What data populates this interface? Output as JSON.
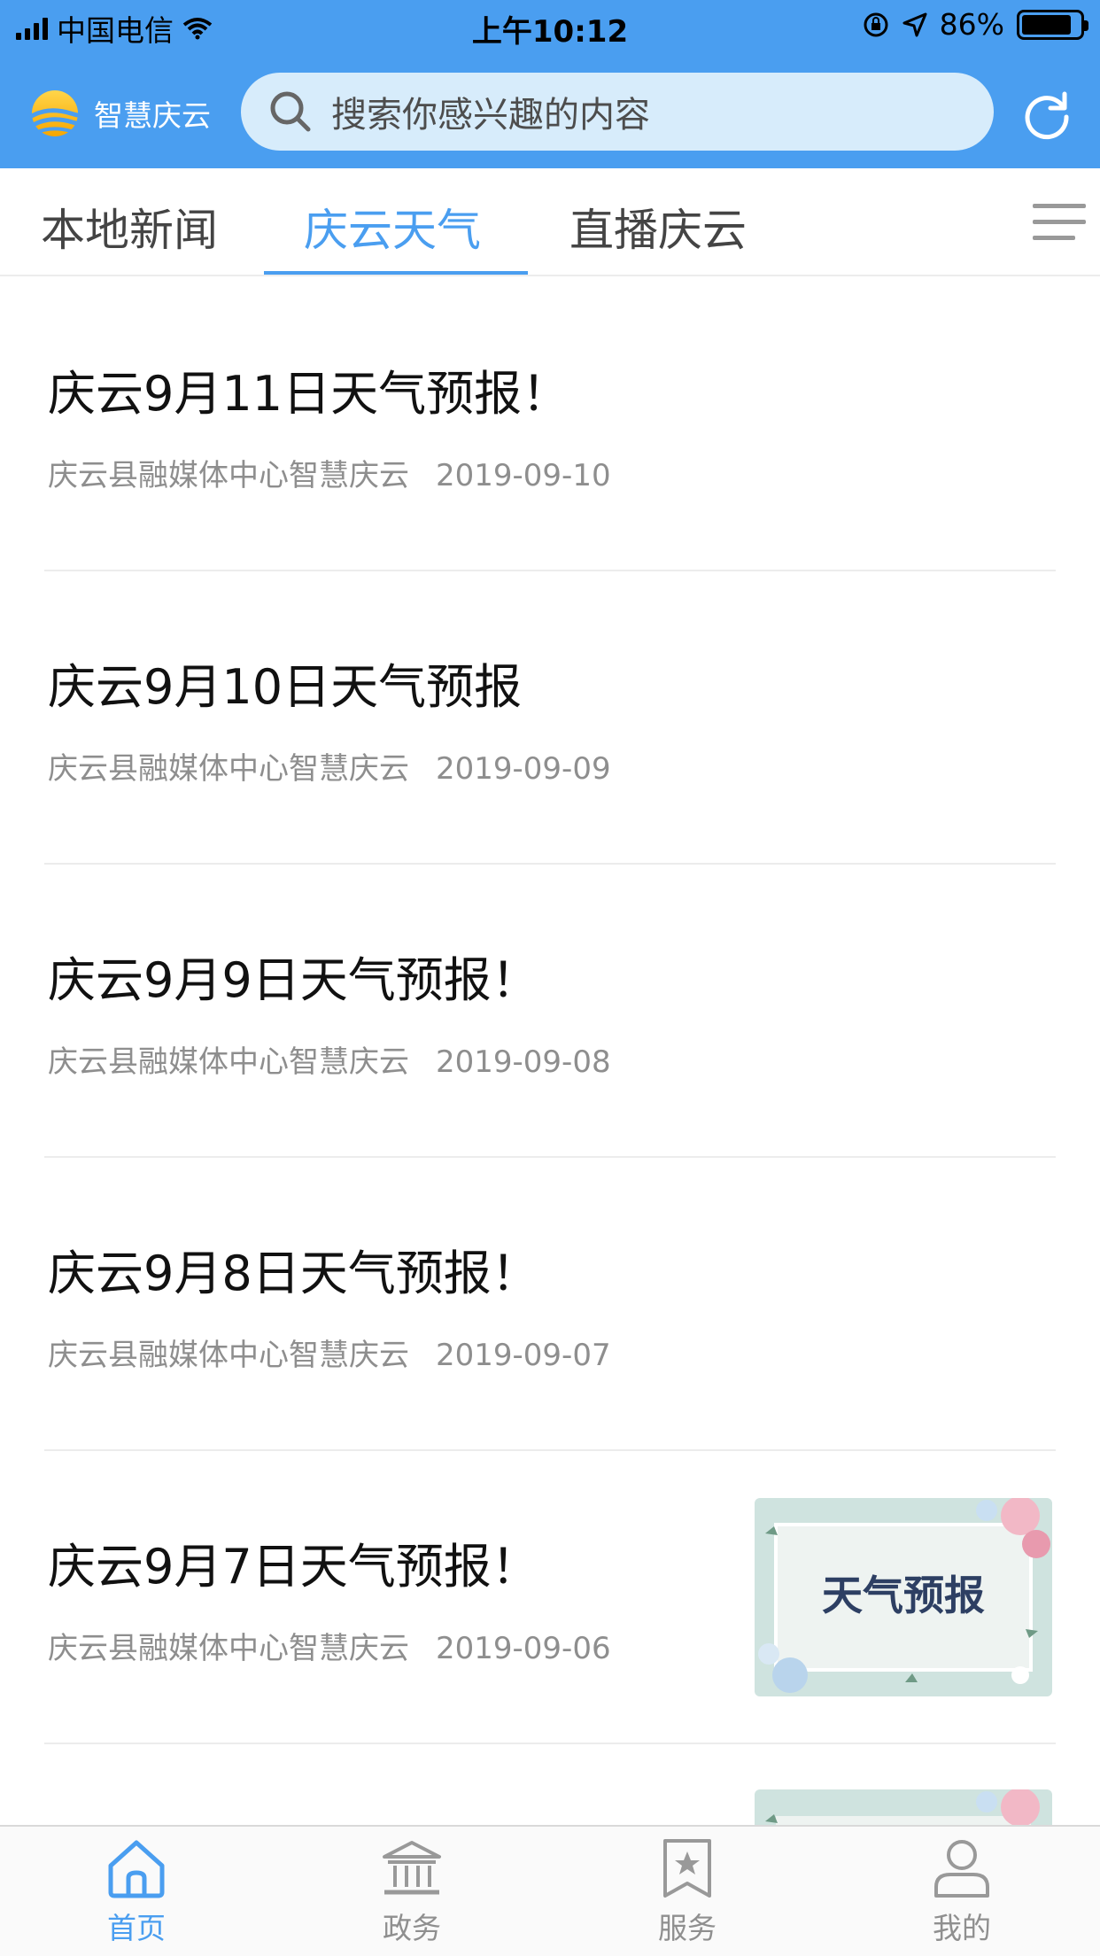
{
  "status_bar": {
    "carrier": "中国电信",
    "time": "上午10:12",
    "battery": "86%",
    "battery_level": 0.86
  },
  "header": {
    "logo_text": "智慧庆云",
    "search_placeholder": "搜索你感兴趣的内容"
  },
  "tabs": [
    {
      "label": "本地新闻",
      "active": false
    },
    {
      "label": "庆云天气",
      "active": true
    },
    {
      "label": "直播庆云",
      "active": false
    }
  ],
  "news": [
    {
      "title": "庆云9月11日天气预报！",
      "source": "庆云县融媒体中心智慧庆云",
      "date": "2019-09-10"
    },
    {
      "title": "庆云9月10日天气预报",
      "source": "庆云县融媒体中心智慧庆云",
      "date": "2019-09-09"
    },
    {
      "title": "庆云9月9日天气预报！",
      "source": "庆云县融媒体中心智慧庆云",
      "date": "2019-09-08"
    },
    {
      "title": "庆云9月8日天气预报！",
      "source": "庆云县融媒体中心智慧庆云",
      "date": "2019-09-07"
    },
    {
      "title": "庆云9月7日天气预报！",
      "source": "庆云县融媒体中心智慧庆云",
      "date": "2019-09-06",
      "thumbnail_text": "天气预报"
    }
  ],
  "tabbar": [
    {
      "label": "首页",
      "icon": "home-icon",
      "active": true
    },
    {
      "label": "政务",
      "icon": "government-icon",
      "active": false
    },
    {
      "label": "服务",
      "icon": "service-icon",
      "active": false
    },
    {
      "label": "我的",
      "icon": "profile-icon",
      "active": false
    }
  ],
  "colors": {
    "accent": "#4a9ef0",
    "search_bg": "#d7ecfb",
    "meta_text": "#8e8e8e"
  }
}
